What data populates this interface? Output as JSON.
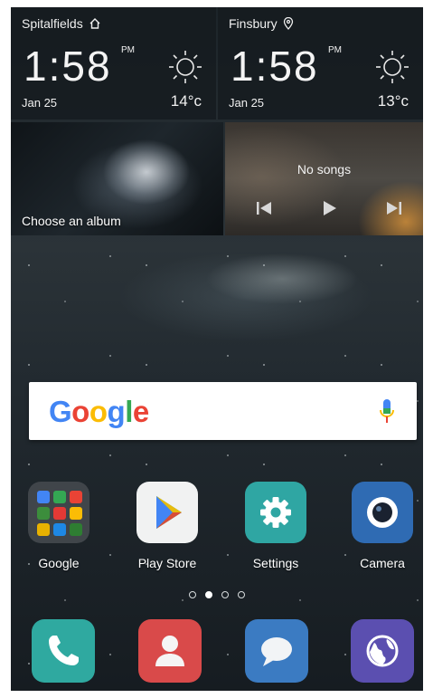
{
  "clock_widgets": [
    {
      "city": "Spitalfields",
      "city_icon": "home-icon",
      "hours": "1",
      "minutes": "58",
      "ampm": "PM",
      "date": "Jan 25",
      "weather_icon": "sun-icon",
      "temperature": "14°c"
    },
    {
      "city": "Finsbury",
      "city_icon": "location-pin-icon",
      "hours": "1",
      "minutes": "58",
      "ampm": "PM",
      "date": "Jan 25",
      "weather_icon": "sun-icon",
      "temperature": "13°c"
    }
  ],
  "gallery_widget": {
    "label": "Choose an album"
  },
  "music_widget": {
    "status": "No songs",
    "controls": [
      "previous-icon",
      "play-icon",
      "next-icon"
    ]
  },
  "search_bar": {
    "logo": [
      "G",
      "o",
      "o",
      "g",
      "l",
      "e"
    ],
    "logo_colors": [
      "#4285F4",
      "#EA4335",
      "#FBBC05",
      "#4285F4",
      "#34A853",
      "#EA4335"
    ],
    "mic_icon": "microphone-icon"
  },
  "apps": [
    {
      "label": "Google",
      "icon": "google-folder-icon"
    },
    {
      "label": "Play Store",
      "icon": "play-store-icon"
    },
    {
      "label": "Settings",
      "icon": "settings-icon"
    },
    {
      "label": "Camera",
      "icon": "camera-icon"
    }
  ],
  "page_indicator": {
    "count": 4,
    "active": 2
  },
  "dock": [
    {
      "icon": "phone-icon",
      "color": "#2fa9a0"
    },
    {
      "icon": "contacts-icon",
      "color": "#d94a4a"
    },
    {
      "icon": "messaging-icon",
      "color": "#3b7bc2"
    },
    {
      "icon": "browser-icon",
      "color": "#5b4fb0"
    }
  ],
  "colors": {
    "settings": "#2fa6a3",
    "camera": "#2f6bb3",
    "folder_bg": "#464b50"
  }
}
